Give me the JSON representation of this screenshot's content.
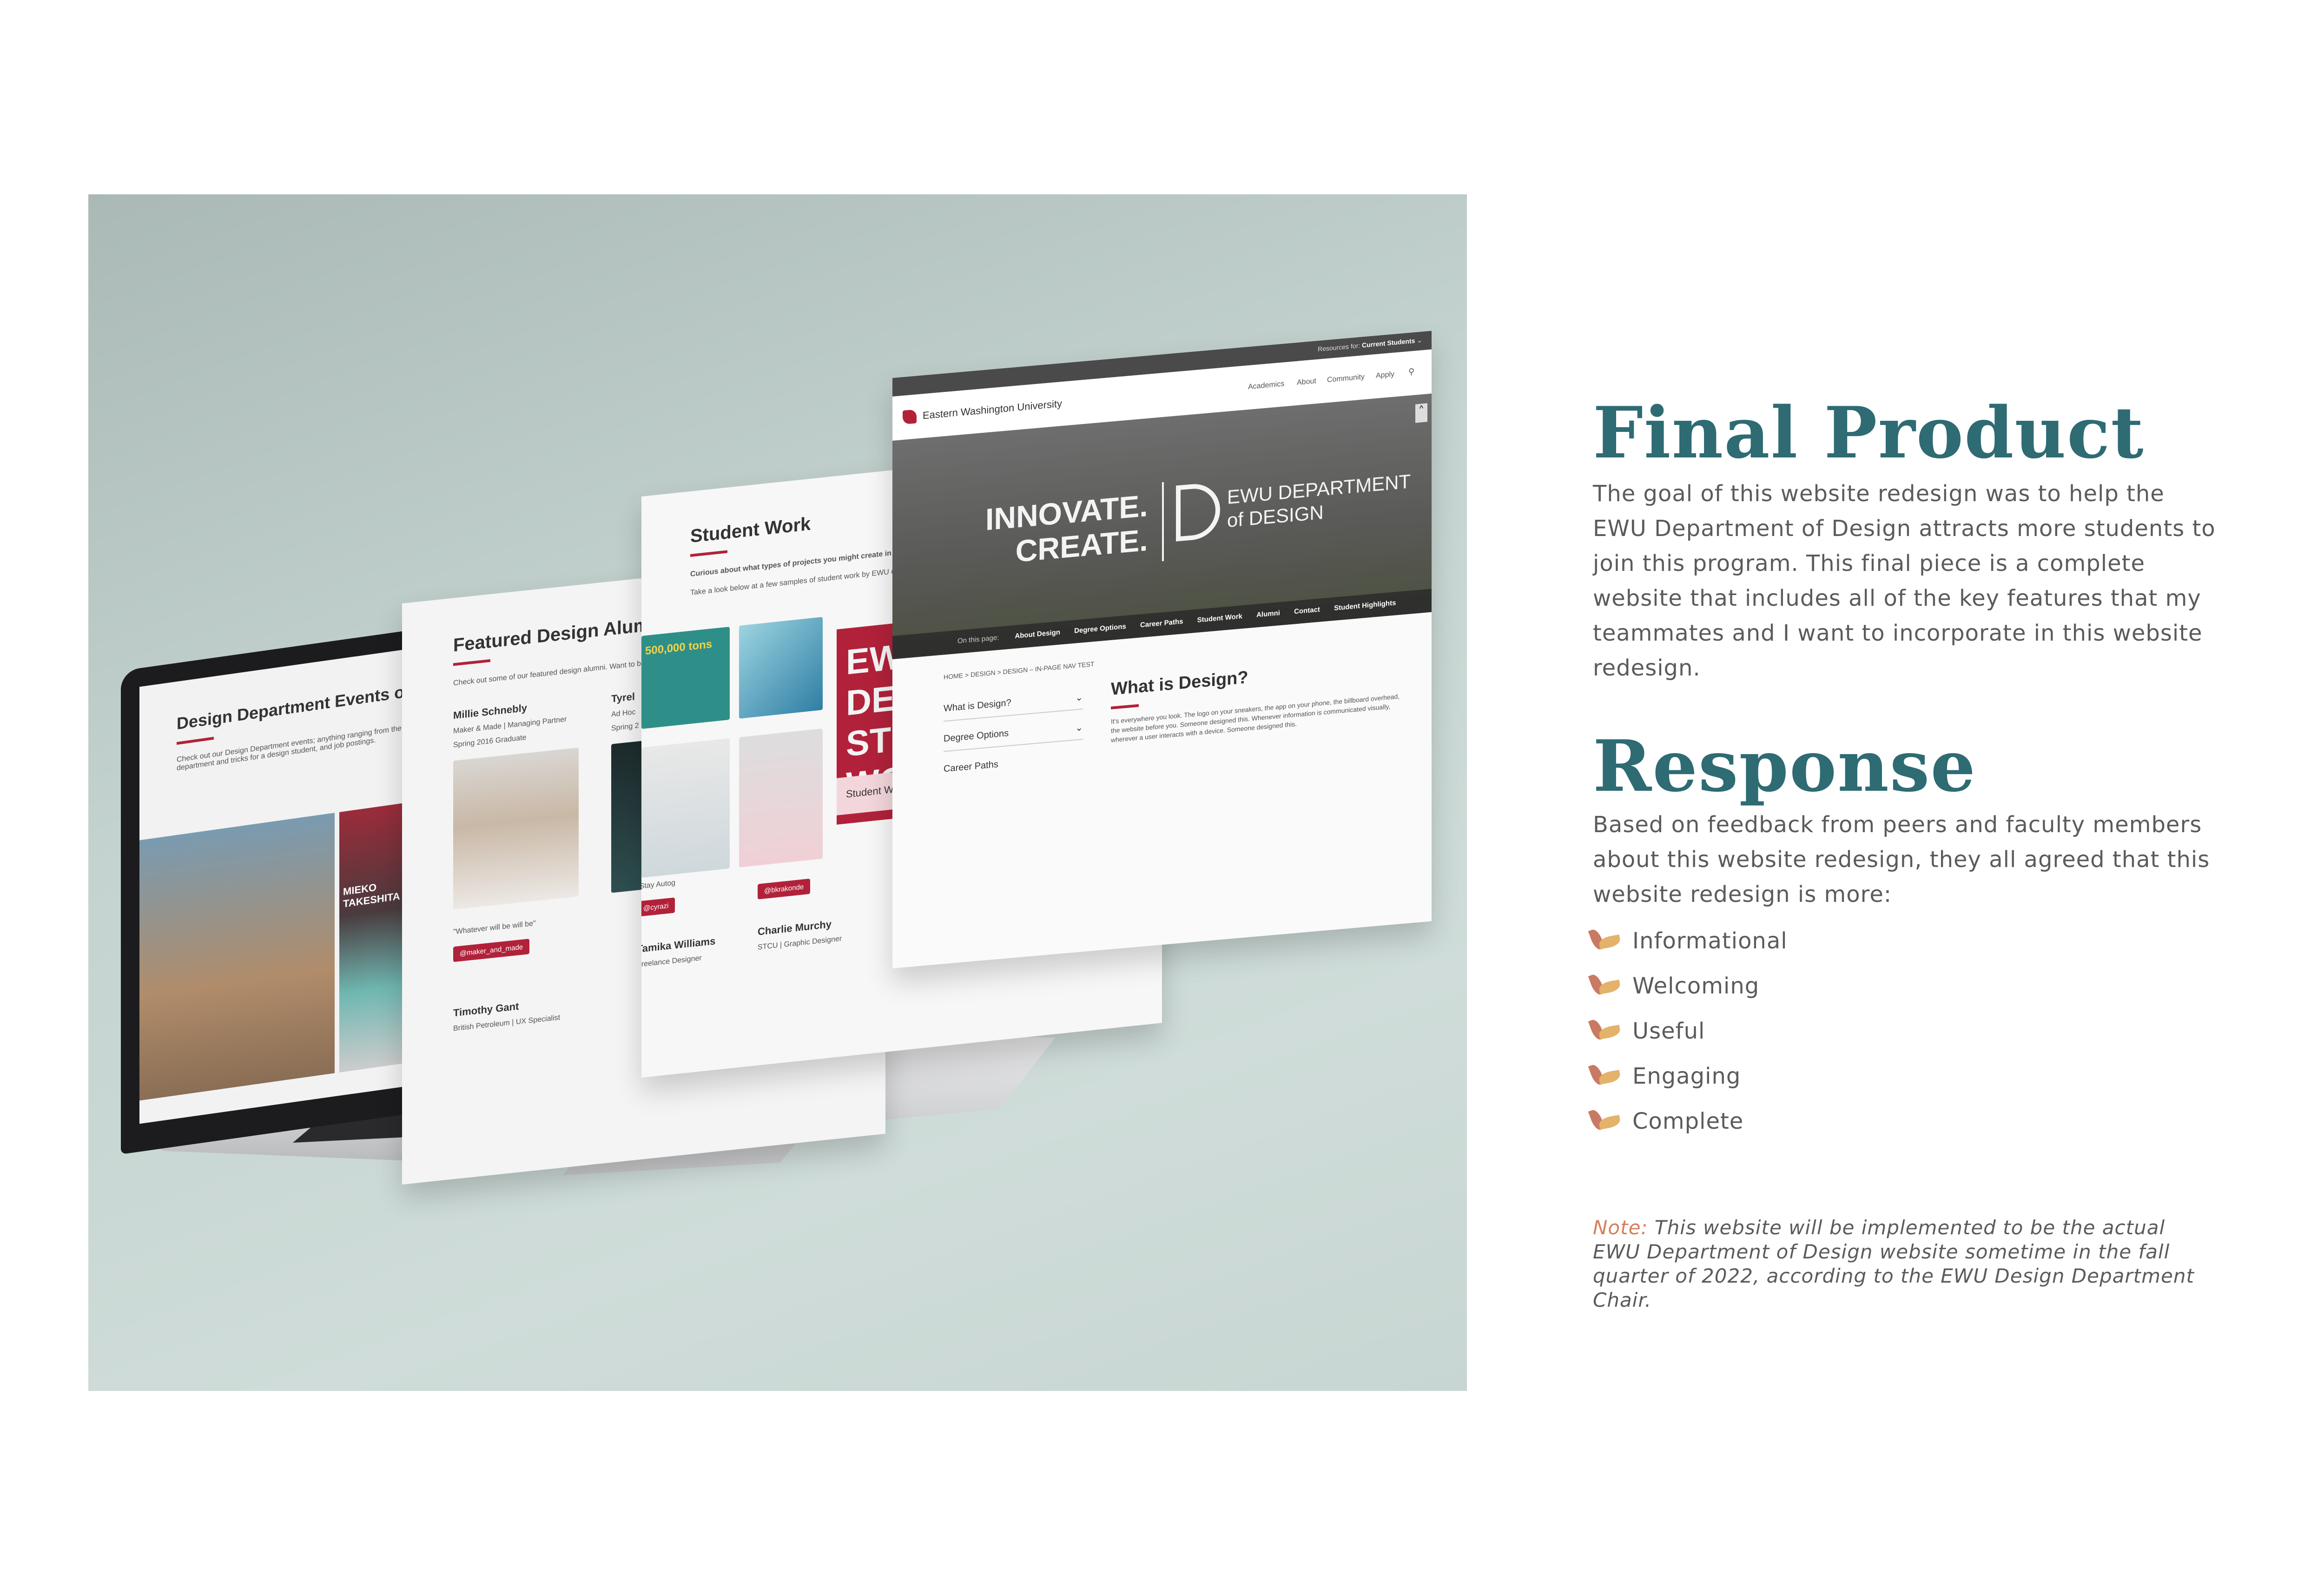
{
  "final_product": {
    "heading": "Final Product",
    "body": "The goal of this website redesign was to help the EWU Department of Design attracts more students to join this program. This final piece is a complete website that includes all of the key features that my teammates and I want to incorporate in this website redesign."
  },
  "response": {
    "heading": "Response",
    "body": "Based on feedback from peers and faculty members about this website redesign, they all agreed that this website redesign is more:",
    "items": [
      "Informational",
      "Welcoming",
      "Useful",
      "Engaging",
      "Complete"
    ],
    "bullet_colors": {
      "petal_dark": "#c97a63",
      "petal_light": "#e4b26a"
    }
  },
  "note": {
    "label": "Note:",
    "text": " This website will be implemented to be the actual EWU Department of Design website sometime in the fall quarter of 2022, according to the EWU Design Department Chair."
  },
  "colors": {
    "heading": "#2e6b73",
    "body": "#5b5b5b",
    "accent_red": "#b1223a",
    "note_label": "#d4805c"
  },
  "mockup": {
    "laptop_page": {
      "title": "Design Department Events on",
      "intro": "Check out our Design Department events; anything ranging from the department and tricks for a design student, and job postings.",
      "event_poster": "MIEKO TAKESHITA"
    },
    "alumni_page": {
      "title": "Featured Design Alumn",
      "intro": "Check out some of our featured design alumni. Want to be",
      "person1_name": "Millie Schnebly",
      "person1_role": "Maker & Made | Managing Partner",
      "person1_grad": "Spring 2016 Graduate",
      "person1_quote": "\"Whatever will be will be\"",
      "person1_handle": "@maker_and_made",
      "person2_name": "Tyrel",
      "person2_role": "Ad Hoc",
      "person2_grad": "Spring 2",
      "person3_name": "Timothy Gant",
      "person3_role": "British Petroleum | UX Specialist"
    },
    "work_page": {
      "title": "Student Work",
      "intro": "Curious about what types of projects you might create in our",
      "subintro": "Take a look below at a few samples of student work by EWU des",
      "poster_text": "500,000 tons",
      "handle1": "@cyrazi",
      "handle2": "@bkrakonde",
      "quote": "\"Stay Autog",
      "person1_name": "Tamika Williams",
      "person1_role": "Freelance Designer",
      "person2_name": "Charlie Murchy",
      "person2_role": "STCU | Graphic Designer",
      "banner_text": "EWU DESIGN STUDENT WORK",
      "examples_label": "Student Work Examples"
    },
    "main_page": {
      "resources_label": "Resources for:",
      "resources_value": "Current Students",
      "university": "Eastern Washington University",
      "nav": [
        "Academics",
        "About",
        "Community",
        "Apply"
      ],
      "hero_line1": "INNOVATE.",
      "hero_line2": "CREATE.",
      "dept_line1": "EWU DEPARTMENT",
      "dept_line2": "of DESIGN",
      "on_this_page": "On this page:",
      "subnav": [
        "About Design",
        "Degree Options",
        "Career Paths",
        "Student Work",
        "Alumni",
        "Contact",
        "Student Highlights"
      ],
      "breadcrumb": "HOME > DESIGN > DESIGN – IN-PAGE NAV TEST",
      "side_links": [
        "What is Design?",
        "Degree Options",
        "Career Paths"
      ],
      "section_title": "What is Design?",
      "section_text": "It's everywhere you look. The logo on your sneakers, the app on your phone, the billboard overhead, the website before you. Someone designed this. Whenever information is communicated visually, wherever a user interacts with a device. Someone designed this."
    }
  }
}
